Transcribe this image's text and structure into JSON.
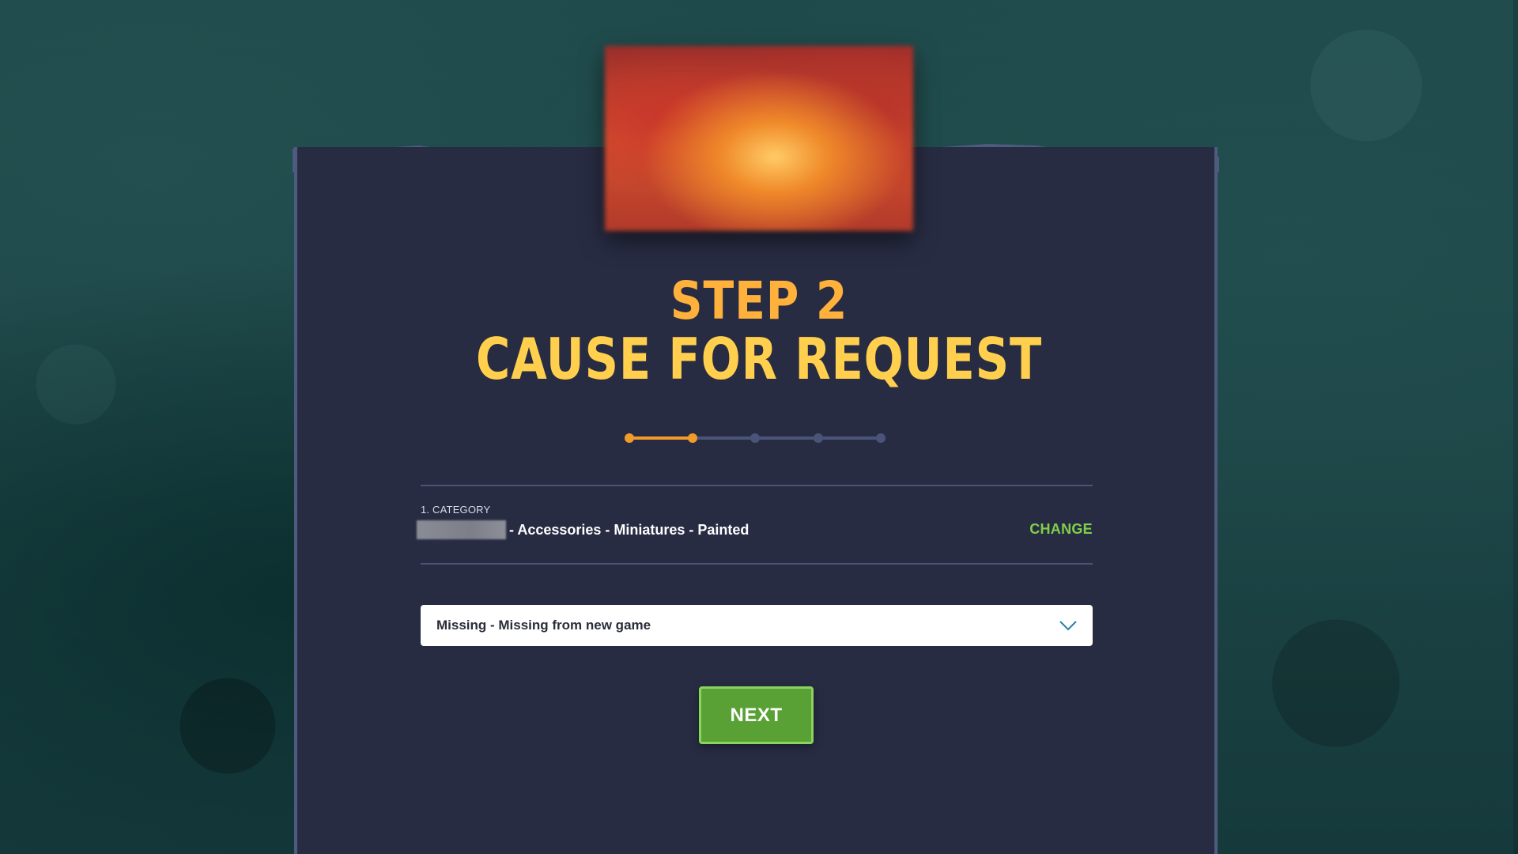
{
  "title": {
    "step": "STEP 2",
    "heading": "CAUSE FOR REQUEST"
  },
  "progress": {
    "current_step": 2,
    "total_steps": 5
  },
  "category": {
    "label": "1. CATEGORY",
    "value": "- Accessories - Miniatures - Painted",
    "change_label": "CHANGE"
  },
  "cause_select": {
    "selected": "Missing - Missing from new game",
    "icon": "chevron-down-icon"
  },
  "next_button": {
    "label": "NEXT"
  },
  "colors": {
    "accent_orange": "#f29b2a",
    "title_yellow": "#ffcf4d",
    "link_green": "#7fd04a",
    "button_green": "#5aa135",
    "panel_bg": "#282c43",
    "page_bg": "#1f4a4b"
  }
}
